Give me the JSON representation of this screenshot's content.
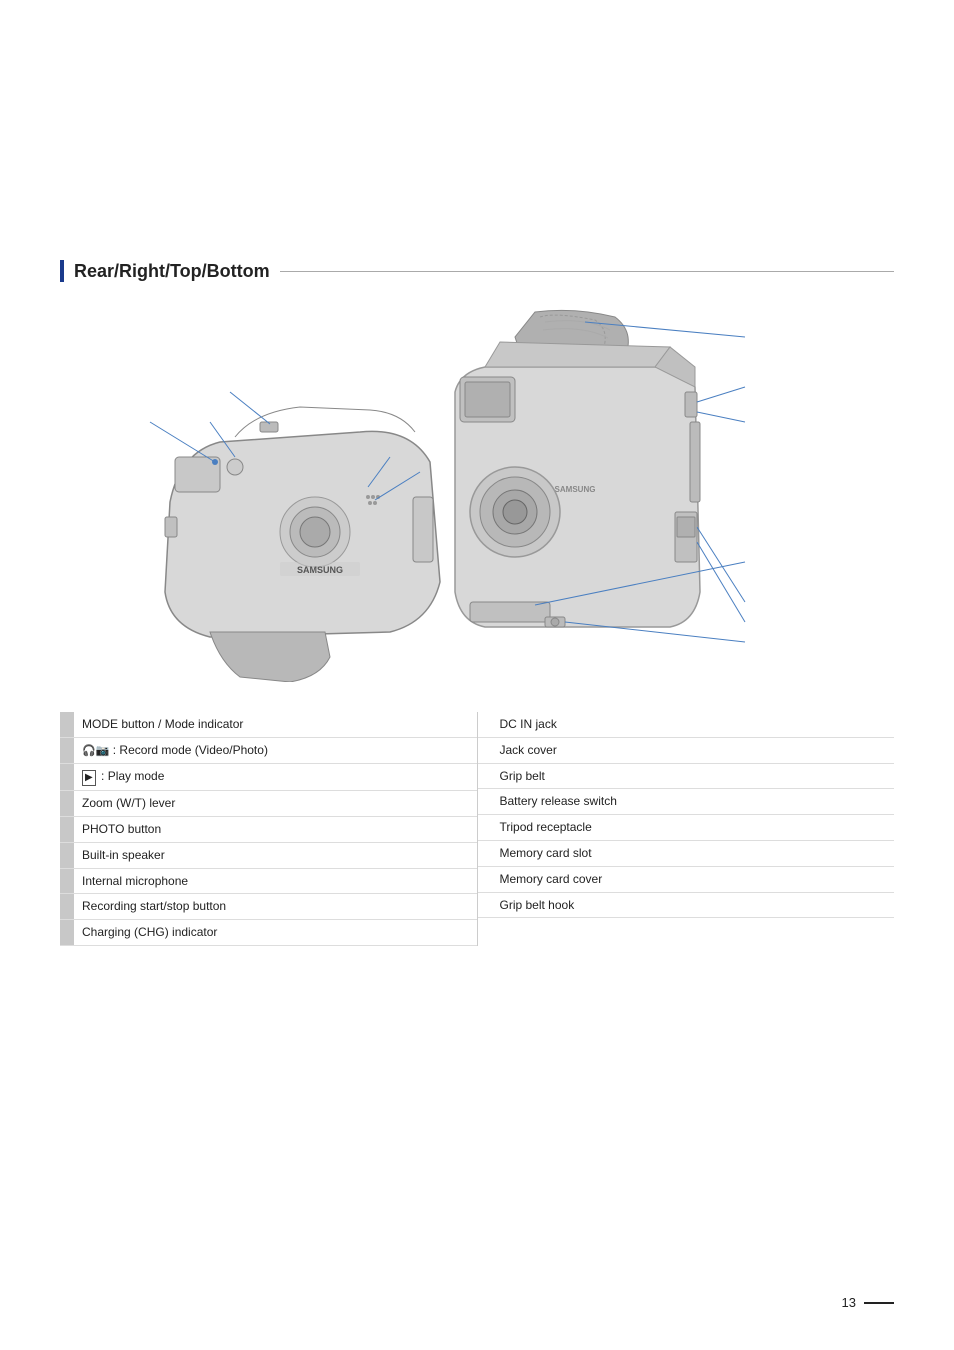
{
  "heading": "Rear/Right/Top/Bottom",
  "left_legend": [
    {
      "bar": "gray",
      "text": "MODE button / Mode indicator"
    },
    {
      "bar": "gray",
      "text": "🎥 : Record mode (Video/Photo)",
      "icon": true
    },
    {
      "bar": "gray",
      "text": "▶ : Play mode",
      "icon": true
    },
    {
      "bar": "gray",
      "text": "Zoom (W/T) lever"
    },
    {
      "bar": "gray",
      "text": "PHOTO button"
    },
    {
      "bar": "gray",
      "text": "Built-in speaker"
    },
    {
      "bar": "gray",
      "text": "Internal microphone"
    },
    {
      "bar": "gray",
      "text": "Recording start/stop button"
    },
    {
      "bar": "gray",
      "text": "Charging (CHG) indicator"
    }
  ],
  "right_legend": [
    {
      "bar": "white",
      "text": "DC IN jack"
    },
    {
      "bar": "white",
      "text": "Jack cover"
    },
    {
      "bar": "white",
      "text": "Grip belt"
    },
    {
      "bar": "white",
      "text": "Battery release switch"
    },
    {
      "bar": "white",
      "text": "Tripod receptacle"
    },
    {
      "bar": "white",
      "text": "Memory card slot"
    },
    {
      "bar": "white",
      "text": "Memory card cover"
    },
    {
      "bar": "white",
      "text": "Grip belt hook"
    }
  ],
  "page_number": "13"
}
